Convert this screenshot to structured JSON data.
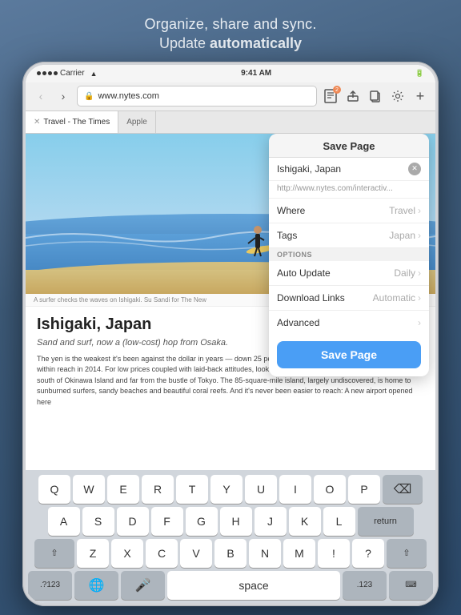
{
  "header": {
    "line1": "Organize, share and sync.",
    "line2_prefix": "Update ",
    "line2_bold": "automatically"
  },
  "status_bar": {
    "carrier": "Carrier",
    "wifi": "WiFi",
    "time": "9:41 AM",
    "battery": "100%"
  },
  "browser": {
    "url": "www.nytes.com",
    "back_label": "‹",
    "forward_label": "›",
    "tab1_label": "Travel - The Times",
    "tab2_label": "Apple",
    "badge_count": "2"
  },
  "article": {
    "image_caption": "A surfer checks the waves on Ishigaki. Su Sandi for The New",
    "title": "Ishigaki, Japan",
    "subtitle": "Sand and surf, now a (low-cost) hop from Osaka.",
    "body": "The yen is the weakest it's been against the dollar in years — down 25 percent from a year ago — putting Japan more within reach in 2014. For low prices coupled with laid-back attitudes, look way south to the island of Ishigaki, 250 miles south of Okinawa Island and far from the bustle of Tokyo. The 85-square-mile island, largely undiscovered, is home to sunburned surfers, sandy beaches and beautiful coral reefs. And it's never been easier to reach: A new airport opened here"
  },
  "popup": {
    "title": "Save Page",
    "name_value": "Ishigaki, Japan",
    "name_placeholder": "Ishigaki, Japan",
    "url_value": "http://www.nytes.com/interactiv...",
    "section_label": "OPTIONS",
    "where_label": "Where",
    "where_value": "Travel",
    "tags_label": "Tags",
    "tags_value": "Japan",
    "auto_update_label": "Auto Update",
    "auto_update_value": "Daily",
    "download_links_label": "Download Links",
    "download_links_value": "Automatic",
    "advanced_label": "Advanced",
    "save_button_label": "Save Page"
  },
  "keyboard": {
    "rows": [
      [
        "Q",
        "W",
        "E",
        "R",
        "T",
        "Y",
        "U",
        "I",
        "O",
        "P"
      ],
      [
        "A",
        "S",
        "D",
        "F",
        "G",
        "H",
        "J",
        "K",
        "L"
      ],
      [
        "Z",
        "X",
        "C",
        "V",
        "B",
        "N",
        "M"
      ],
      [
        "123",
        "🌐",
        "space",
        ".123",
        "return"
      ]
    ]
  }
}
